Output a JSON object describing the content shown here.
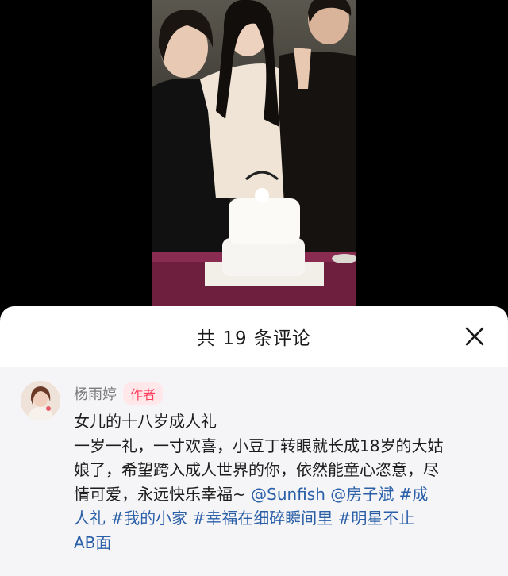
{
  "comments_sheet": {
    "title": "共 19 条评论",
    "close_icon": "close-icon"
  },
  "comment": {
    "author": "杨雨婷",
    "author_badge": "作者",
    "avatar_icon": "avatar",
    "line1": "女儿的十八岁成人礼",
    "line2": "一岁一礼，一寸欢喜，小豆丁转眼就长成18岁的大姑",
    "line3": "娘了，希望跨入成人世界的你，依然能童心恣意，尽",
    "line4_text": "情可爱，永远快乐幸福~ ",
    "mention_sunfish": "@Sunfish",
    "mention_fang": "@房子斌",
    "tag_chengren_part1": "#成",
    "tag_chengren_part2": "人礼",
    "tag_xiaojia": "#我的小家",
    "tag_xingfu": "#幸福在细碎瞬间里",
    "tag_mingxing_part1": "#明星不止",
    "tag_mingxing_part2": "AB面"
  },
  "colors": {
    "link": "#2a5fa8",
    "badge_text": "#ff4060",
    "badge_bg": "#ffe7ea"
  }
}
